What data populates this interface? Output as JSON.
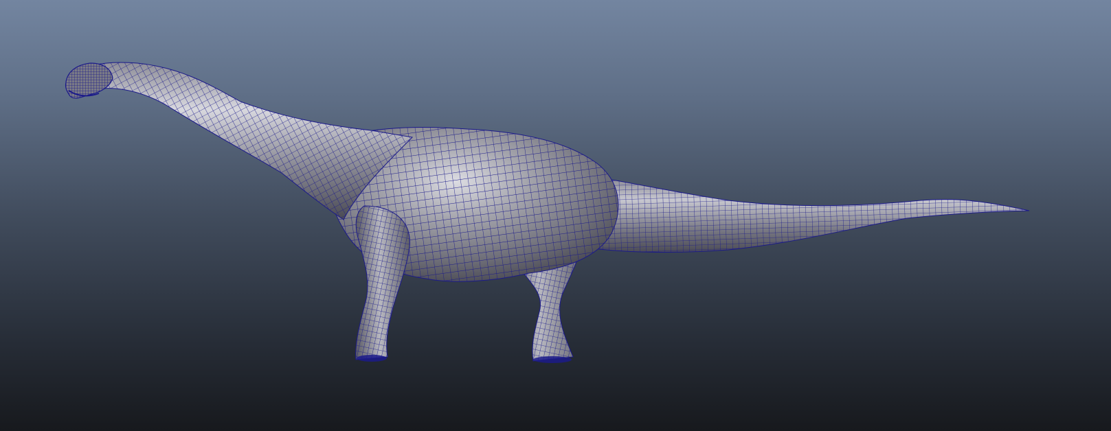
{
  "viewport": {
    "background_top": "#7385a0",
    "background_bottom": "#17191d"
  },
  "model": {
    "subject": "sauropod-dinosaur-wireframe-mesh",
    "surface_color": "#9c9ca4",
    "wire_color": "#1b1a8a",
    "shading": "smooth-shaded-with-wireframe"
  }
}
